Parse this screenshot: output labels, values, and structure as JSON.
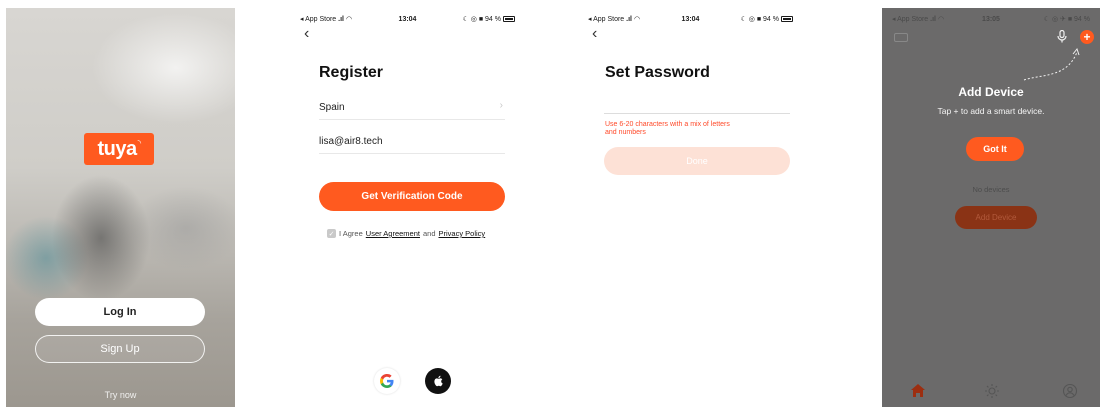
{
  "splash": {
    "logo_text": "tuya",
    "login_label": "Log In",
    "signup_label": "Sign Up",
    "try_now_label": "Try now"
  },
  "register": {
    "status": {
      "carrier": "◂ App Store",
      "time": "13:04",
      "battery": "94 %"
    },
    "back_icon": "chevron-left-icon",
    "title": "Register",
    "country_value": "Spain",
    "email_value": "lisa@air8.tech",
    "verify_button": "Get Verification Code",
    "agree_prefix": "I Agree",
    "user_agreement": "User Agreement",
    "agree_and": "and",
    "privacy_policy": "Privacy Policy"
  },
  "set_password": {
    "status": {
      "carrier": "◂ App Store",
      "time": "13:04",
      "battery": "94 %"
    },
    "title": "Set Password",
    "hint_line1": "Use 6-20 characters with a mix of letters",
    "hint_line2": "and numbers",
    "done_button": "Done"
  },
  "add_device": {
    "status": {
      "carrier": "◂ App Store",
      "time": "13:05",
      "battery": "94 %"
    },
    "title": "Add Device",
    "subtitle": "Tap + to add a smart device.",
    "got_it": "Got It",
    "no_devices": "No devices",
    "add_device_button": "Add Device"
  },
  "colors": {
    "accent": "#ff5a1f",
    "hint_red": "#ff4a2a",
    "done_disabled": "#fde1d6",
    "overlay": "#6b6a6a"
  }
}
